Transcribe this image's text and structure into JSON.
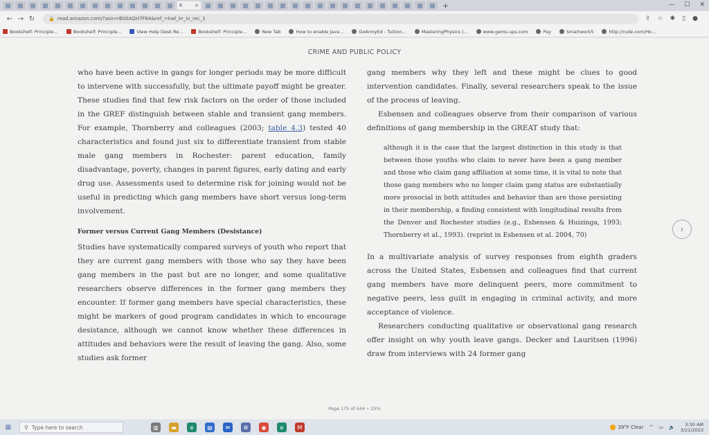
{
  "browser": {
    "tab_count": 34,
    "active_tab_letter": "K",
    "close_glyph": "×",
    "new_tab_glyph": "+",
    "window_controls": [
      "—",
      "☐",
      "✕"
    ],
    "url": "read.amazon.com/?asin=B00AQH7F64&ref_=kwl_kr_iv_rec_1",
    "bookmarks": [
      {
        "label": "Bookshelf: Principle...",
        "icon": "bookshelf-icon"
      },
      {
        "label": "Bookshelf: Principle...",
        "icon": "bookshelf-icon"
      },
      {
        "label": "View Help Desk Re...",
        "icon": "helpdesk-icon"
      },
      {
        "label": "Bookshelf: Principle...",
        "icon": "bookshelf-icon"
      },
      {
        "label": "New Tab",
        "icon": "globe-icon"
      },
      {
        "label": "How to enable Java...",
        "icon": "java-icon"
      },
      {
        "label": "GoArmyEd - Tuition...",
        "icon": "globe-icon"
      },
      {
        "label": "MasteringPhysics |...",
        "icon": "globe-icon"
      },
      {
        "label": "www.gems.ups.com",
        "icon": "globe-icon"
      },
      {
        "label": "Pay",
        "icon": "globe-icon"
      },
      {
        "label": "Smartwork5",
        "icon": "globe-icon"
      },
      {
        "label": "http://rude.com/Ho...",
        "icon": "globe-icon"
      }
    ]
  },
  "reader": {
    "running_head": "CRIME AND PUBLIC POLICY",
    "left": {
      "p1_before_link": "who have been active in gangs for longer periods may be more difficult to intervene with successfully, but the ultimate payoff might be greater. These studies find that few risk factors on the order of those included in the GREF distinguish between stable and transient gang members. For example, Thornberry and colleagues (2003; ",
      "p1_link": "table 4.3",
      "p1_after_link": ") tested 40 characteristics and found just six to differentiate transient from stable male gang members in Rochester: parent education, family disadvantage, poverty, changes in parent figures, early dating and early drug use. Assessments used to determine risk for joining would not be useful in predicting which gang members have short versus long-term involvement.",
      "section_heading": "Former versus Current Gang Members (Desistance)",
      "p2": "Studies have systematically compared surveys of youth who report that they are current gang members with those who say they have been gang members in the past but are no longer, and some qualitative researchers observe differences in the former gang members they encounter. If former gang members have special characteristics, these might be markers of good program candidates in which to encourage desistance, although we cannot know whether these differences in attitudes and behaviors were the result of leaving the gang. Also, some studies ask former"
    },
    "right": {
      "p1": "gang members why they left and these might be clues to good intervention candidates. Finally, several researchers speak to the issue of the process of leaving.",
      "p2": "Esbensen and colleagues observe from their comparison of various definitions of gang membership in the GREAT study that:",
      "blockquote": "although it is the case that the largest distinction in this study is that between those youths who claim to never have been a gang member and those who claim gang affiliation at some time, it is vital to note that those gang members who no longer claim gang status are substantially more prosocial in both attitudes and behavior than are those persisting in their membership, a finding consistent with longitudinal results from the Denver and Rochester studies (e.g., Esbensen & Huizinga, 1993; Thornberry et al., 1993). (reprint in Esbensen et al. 2004, 70)",
      "p3": "In a multivariate analysis of survey responses from eighth graders across the United States, Esbensen and colleagues find that current gang members have more delinquent peers, more commitment to negative peers, less guilt in engaging in criminal activity, and more acceptance of violence.",
      "p4": "Researchers conducting qualitative or observational gang research offer insight on why youth leave gangs. Decker and Lauritsen (1996) draw from interviews with 24 former gang"
    },
    "next_page_glyph": "›",
    "footer": "Page 175 of 644 • 25%"
  },
  "taskbar": {
    "search_placeholder": "Type here to search",
    "weather": "39°F Clear",
    "time": "3:30 AM",
    "date": "3/21/2023"
  },
  "colors": {
    "page_bg": "#f2f2f1",
    "link": "#3a5fa8",
    "taskbar_bg": "#dfe3ea"
  }
}
